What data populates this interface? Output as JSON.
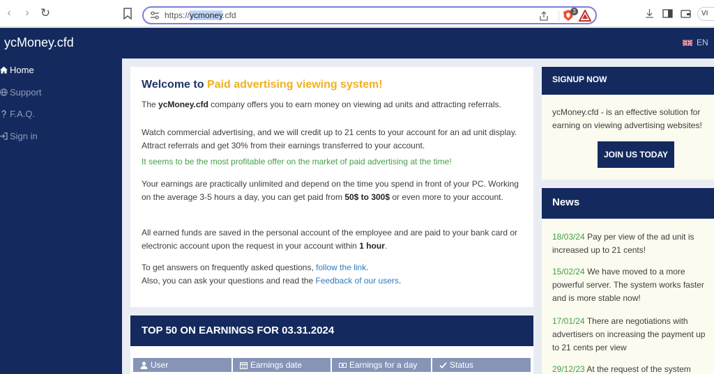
{
  "browser": {
    "url_scheme": "https://",
    "url_host": "ycmoney",
    "url_tld": ".cfd",
    "shields_count": "3",
    "vpn_label": "VI"
  },
  "header": {
    "logo": "ycMoney.cfd",
    "language": "EN"
  },
  "sidebar": {
    "items": [
      {
        "label": "Home",
        "icon": "home-icon"
      },
      {
        "label": "Support",
        "icon": "globe-icon"
      },
      {
        "label": "F.A.Q.",
        "icon": "question-icon"
      },
      {
        "label": "Sign in",
        "icon": "sign-in-icon"
      }
    ]
  },
  "welcome": {
    "title_prefix": "Welcome to",
    "title_highlight": "Paid advertising viewing system!",
    "p1_pre": "The",
    "p1_brand": "ycMoney.cfd",
    "p1_post": "company offers you to earn money on viewing ad units and attracting referrals.",
    "p2": "Watch commercial advertising, and we will credit up to 21 cents to your account for an ad unit display. Attract referrals and get 30% from their earnings transferred to your account.",
    "p3": "It seems to be the most profitable offer on the market of paid advertising at the time!",
    "p4_pre": "Your earnings are practically unlimited and depend on the time you spend in front of your PC. Working on the average 3-5 hours a day, you can get paid from",
    "p4_bold": "50$ to 300$",
    "p4_post": "or even more to your account.",
    "p5_pre": "All earned funds are saved in the personal account of the employee and are paid to your bank card or electronic account upon the request in your account within",
    "p5_bold": "1 hour",
    "p5_post": ".",
    "p6_pre": "To get answers on frequently asked questions,",
    "p6_link": "follow the link",
    "p6_post": ".",
    "p7_pre": "Also, you can ask your questions and read the",
    "p7_link": "Feedback of our users",
    "p7_post": "."
  },
  "top50": {
    "title": "TOP 50 ON EARNINGS FOR 03.31.2024",
    "columns": [
      {
        "label": "User",
        "icon": "user-icon"
      },
      {
        "label": "Earnings date",
        "icon": "calendar-icon"
      },
      {
        "label": "Earnings for a day",
        "icon": "money-icon"
      },
      {
        "label": "Status",
        "icon": "check-icon"
      }
    ]
  },
  "signup": {
    "title": "SIGNUP NOW",
    "text": "ycMoney.cfd - is an effective solution for earning on viewing advertising websites!",
    "button": "JOIN US TODAY"
  },
  "news": {
    "title": "News",
    "items": [
      {
        "date": "18/03/24",
        "text": "Pay per view of the ad unit is increased up to 21 cents!"
      },
      {
        "date": "15/02/24",
        "text": "We have moved to a more powerful server. The system works faster and is more stable now!"
      },
      {
        "date": "17/01/24",
        "text": "There are negotiations with advertisers on increasing the payment up to 21 cents per view"
      },
      {
        "date": "29/12/23",
        "text": "At the request of the system"
      }
    ]
  },
  "colors": {
    "navy": "#142a5e",
    "accent_yellow": "#f0b020",
    "green": "#43a047",
    "link": "#2a7bc0"
  }
}
